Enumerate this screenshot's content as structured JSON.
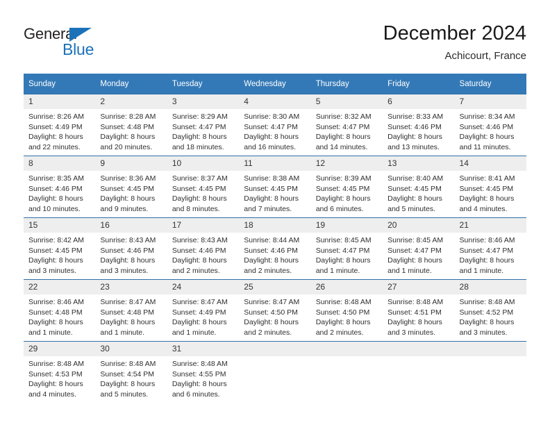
{
  "brand": {
    "name_top": "General",
    "name_bottom": "Blue",
    "triangle_color": "#1b72b8"
  },
  "header": {
    "title": "December 2024",
    "subtitle": "Achicourt, France"
  },
  "theme": {
    "header_bg": "#3479b7",
    "row_border": "#2f6fa8",
    "daynum_bg": "#eeeeee"
  },
  "calendar": {
    "weekday_headers": [
      "Sunday",
      "Monday",
      "Tuesday",
      "Wednesday",
      "Thursday",
      "Friday",
      "Saturday"
    ],
    "weeks": [
      [
        {
          "day": "1",
          "sunrise": "Sunrise: 8:26 AM",
          "sunset": "Sunset: 4:49 PM",
          "daylight_line1": "Daylight: 8 hours",
          "daylight_line2": "and 22 minutes."
        },
        {
          "day": "2",
          "sunrise": "Sunrise: 8:28 AM",
          "sunset": "Sunset: 4:48 PM",
          "daylight_line1": "Daylight: 8 hours",
          "daylight_line2": "and 20 minutes."
        },
        {
          "day": "3",
          "sunrise": "Sunrise: 8:29 AM",
          "sunset": "Sunset: 4:47 PM",
          "daylight_line1": "Daylight: 8 hours",
          "daylight_line2": "and 18 minutes."
        },
        {
          "day": "4",
          "sunrise": "Sunrise: 8:30 AM",
          "sunset": "Sunset: 4:47 PM",
          "daylight_line1": "Daylight: 8 hours",
          "daylight_line2": "and 16 minutes."
        },
        {
          "day": "5",
          "sunrise": "Sunrise: 8:32 AM",
          "sunset": "Sunset: 4:47 PM",
          "daylight_line1": "Daylight: 8 hours",
          "daylight_line2": "and 14 minutes."
        },
        {
          "day": "6",
          "sunrise": "Sunrise: 8:33 AM",
          "sunset": "Sunset: 4:46 PM",
          "daylight_line1": "Daylight: 8 hours",
          "daylight_line2": "and 13 minutes."
        },
        {
          "day": "7",
          "sunrise": "Sunrise: 8:34 AM",
          "sunset": "Sunset: 4:46 PM",
          "daylight_line1": "Daylight: 8 hours",
          "daylight_line2": "and 11 minutes."
        }
      ],
      [
        {
          "day": "8",
          "sunrise": "Sunrise: 8:35 AM",
          "sunset": "Sunset: 4:46 PM",
          "daylight_line1": "Daylight: 8 hours",
          "daylight_line2": "and 10 minutes."
        },
        {
          "day": "9",
          "sunrise": "Sunrise: 8:36 AM",
          "sunset": "Sunset: 4:45 PM",
          "daylight_line1": "Daylight: 8 hours",
          "daylight_line2": "and 9 minutes."
        },
        {
          "day": "10",
          "sunrise": "Sunrise: 8:37 AM",
          "sunset": "Sunset: 4:45 PM",
          "daylight_line1": "Daylight: 8 hours",
          "daylight_line2": "and 8 minutes."
        },
        {
          "day": "11",
          "sunrise": "Sunrise: 8:38 AM",
          "sunset": "Sunset: 4:45 PM",
          "daylight_line1": "Daylight: 8 hours",
          "daylight_line2": "and 7 minutes."
        },
        {
          "day": "12",
          "sunrise": "Sunrise: 8:39 AM",
          "sunset": "Sunset: 4:45 PM",
          "daylight_line1": "Daylight: 8 hours",
          "daylight_line2": "and 6 minutes."
        },
        {
          "day": "13",
          "sunrise": "Sunrise: 8:40 AM",
          "sunset": "Sunset: 4:45 PM",
          "daylight_line1": "Daylight: 8 hours",
          "daylight_line2": "and 5 minutes."
        },
        {
          "day": "14",
          "sunrise": "Sunrise: 8:41 AM",
          "sunset": "Sunset: 4:45 PM",
          "daylight_line1": "Daylight: 8 hours",
          "daylight_line2": "and 4 minutes."
        }
      ],
      [
        {
          "day": "15",
          "sunrise": "Sunrise: 8:42 AM",
          "sunset": "Sunset: 4:45 PM",
          "daylight_line1": "Daylight: 8 hours",
          "daylight_line2": "and 3 minutes."
        },
        {
          "day": "16",
          "sunrise": "Sunrise: 8:43 AM",
          "sunset": "Sunset: 4:46 PM",
          "daylight_line1": "Daylight: 8 hours",
          "daylight_line2": "and 3 minutes."
        },
        {
          "day": "17",
          "sunrise": "Sunrise: 8:43 AM",
          "sunset": "Sunset: 4:46 PM",
          "daylight_line1": "Daylight: 8 hours",
          "daylight_line2": "and 2 minutes."
        },
        {
          "day": "18",
          "sunrise": "Sunrise: 8:44 AM",
          "sunset": "Sunset: 4:46 PM",
          "daylight_line1": "Daylight: 8 hours",
          "daylight_line2": "and 2 minutes."
        },
        {
          "day": "19",
          "sunrise": "Sunrise: 8:45 AM",
          "sunset": "Sunset: 4:47 PM",
          "daylight_line1": "Daylight: 8 hours",
          "daylight_line2": "and 1 minute."
        },
        {
          "day": "20",
          "sunrise": "Sunrise: 8:45 AM",
          "sunset": "Sunset: 4:47 PM",
          "daylight_line1": "Daylight: 8 hours",
          "daylight_line2": "and 1 minute."
        },
        {
          "day": "21",
          "sunrise": "Sunrise: 8:46 AM",
          "sunset": "Sunset: 4:47 PM",
          "daylight_line1": "Daylight: 8 hours",
          "daylight_line2": "and 1 minute."
        }
      ],
      [
        {
          "day": "22",
          "sunrise": "Sunrise: 8:46 AM",
          "sunset": "Sunset: 4:48 PM",
          "daylight_line1": "Daylight: 8 hours",
          "daylight_line2": "and 1 minute."
        },
        {
          "day": "23",
          "sunrise": "Sunrise: 8:47 AM",
          "sunset": "Sunset: 4:48 PM",
          "daylight_line1": "Daylight: 8 hours",
          "daylight_line2": "and 1 minute."
        },
        {
          "day": "24",
          "sunrise": "Sunrise: 8:47 AM",
          "sunset": "Sunset: 4:49 PM",
          "daylight_line1": "Daylight: 8 hours",
          "daylight_line2": "and 1 minute."
        },
        {
          "day": "25",
          "sunrise": "Sunrise: 8:47 AM",
          "sunset": "Sunset: 4:50 PM",
          "daylight_line1": "Daylight: 8 hours",
          "daylight_line2": "and 2 minutes."
        },
        {
          "day": "26",
          "sunrise": "Sunrise: 8:48 AM",
          "sunset": "Sunset: 4:50 PM",
          "daylight_line1": "Daylight: 8 hours",
          "daylight_line2": "and 2 minutes."
        },
        {
          "day": "27",
          "sunrise": "Sunrise: 8:48 AM",
          "sunset": "Sunset: 4:51 PM",
          "daylight_line1": "Daylight: 8 hours",
          "daylight_line2": "and 3 minutes."
        },
        {
          "day": "28",
          "sunrise": "Sunrise: 8:48 AM",
          "sunset": "Sunset: 4:52 PM",
          "daylight_line1": "Daylight: 8 hours",
          "daylight_line2": "and 3 minutes."
        }
      ],
      [
        {
          "day": "29",
          "sunrise": "Sunrise: 8:48 AM",
          "sunset": "Sunset: 4:53 PM",
          "daylight_line1": "Daylight: 8 hours",
          "daylight_line2": "and 4 minutes."
        },
        {
          "day": "30",
          "sunrise": "Sunrise: 8:48 AM",
          "sunset": "Sunset: 4:54 PM",
          "daylight_line1": "Daylight: 8 hours",
          "daylight_line2": "and 5 minutes."
        },
        {
          "day": "31",
          "sunrise": "Sunrise: 8:48 AM",
          "sunset": "Sunset: 4:55 PM",
          "daylight_line1": "Daylight: 8 hours",
          "daylight_line2": "and 6 minutes."
        },
        {
          "day": "",
          "sunrise": "",
          "sunset": "",
          "daylight_line1": "",
          "daylight_line2": ""
        },
        {
          "day": "",
          "sunrise": "",
          "sunset": "",
          "daylight_line1": "",
          "daylight_line2": ""
        },
        {
          "day": "",
          "sunrise": "",
          "sunset": "",
          "daylight_line1": "",
          "daylight_line2": ""
        },
        {
          "day": "",
          "sunrise": "",
          "sunset": "",
          "daylight_line1": "",
          "daylight_line2": ""
        }
      ]
    ]
  }
}
